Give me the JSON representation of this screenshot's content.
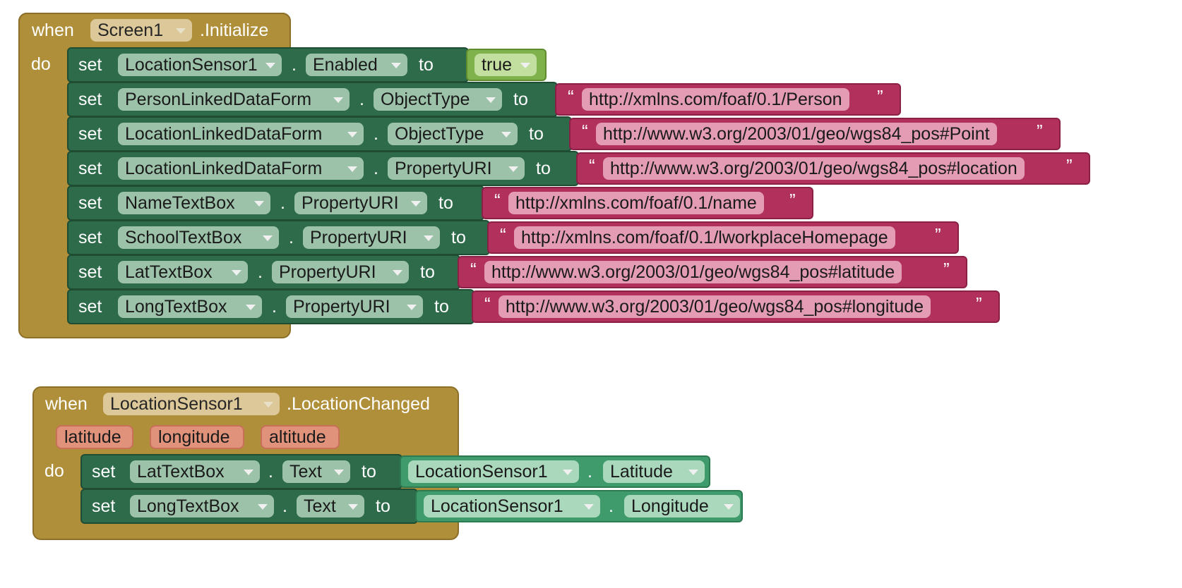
{
  "colors": {
    "event_block": "#b08f3a",
    "setter_block": "#2e6b4a",
    "string_block": "#b1305c",
    "boolean_block": "#7fb24a",
    "getter_block": "#3f9a6c",
    "parameter": "#e0927a"
  },
  "block1": {
    "when": "when",
    "component": "Screen1",
    "event": ".Initialize",
    "do": "do",
    "rows": [
      {
        "set": "set",
        "component": "LocationSensor1",
        "dot": ".",
        "property": "Enabled",
        "to": "to",
        "value_type": "boolean",
        "value": "true"
      },
      {
        "set": "set",
        "component": "PersonLinkedDataForm",
        "dot": ".",
        "property": "ObjectType",
        "to": "to",
        "value_type": "string",
        "open_quote": "“",
        "value": "http://xmlns.com/foaf/0.1/Person",
        "close_quote": "”"
      },
      {
        "set": "set",
        "component": "LocationLinkedDataForm",
        "dot": ".",
        "property": "ObjectType",
        "to": "to",
        "value_type": "string",
        "open_quote": "“",
        "value": "http://www.w3.org/2003/01/geo/wgs84_pos#Point",
        "close_quote": "”"
      },
      {
        "set": "set",
        "component": "LocationLinkedDataForm",
        "dot": ".",
        "property": "PropertyURI",
        "to": "to",
        "value_type": "string",
        "open_quote": "“",
        "value": "http://www.w3.org/2003/01/geo/wgs84_pos#location",
        "close_quote": "”"
      },
      {
        "set": "set",
        "component": "NameTextBox",
        "dot": ".",
        "property": "PropertyURI",
        "to": "to",
        "value_type": "string",
        "open_quote": "“",
        "value": "http://xmlns.com/foaf/0.1/name",
        "close_quote": "”"
      },
      {
        "set": "set",
        "component": "SchoolTextBox",
        "dot": ".",
        "property": "PropertyURI",
        "to": "to",
        "value_type": "string",
        "open_quote": "“",
        "value": "http://xmlns.com/foaf/0.1/lworkplaceHomepage",
        "close_quote": "”"
      },
      {
        "set": "set",
        "component": "LatTextBox",
        "dot": ".",
        "property": "PropertyURI",
        "to": "to",
        "value_type": "string",
        "open_quote": "“",
        "value": "http://www.w3.org/2003/01/geo/wgs84_pos#latitude",
        "close_quote": "”"
      },
      {
        "set": "set",
        "component": "LongTextBox",
        "dot": ".",
        "property": "PropertyURI",
        "to": "to",
        "value_type": "string",
        "open_quote": "“",
        "value": "http://www.w3.org/2003/01/geo/wgs84_pos#longitude",
        "close_quote": "”"
      }
    ]
  },
  "block2": {
    "when": "when",
    "component": "LocationSensor1",
    "event": ".LocationChanged",
    "params": [
      "latitude",
      "longitude",
      "altitude"
    ],
    "do": "do",
    "rows": [
      {
        "set": "set",
        "component": "LatTextBox",
        "dot": ".",
        "property": "Text",
        "to": "to",
        "value_type": "getter",
        "get_component": "LocationSensor1",
        "get_dot": ".",
        "get_property": "Latitude"
      },
      {
        "set": "set",
        "component": "LongTextBox",
        "dot": ".",
        "property": "Text",
        "to": "to",
        "value_type": "getter",
        "get_component": "LocationSensor1",
        "get_dot": ".",
        "get_property": "Longitude"
      }
    ]
  }
}
